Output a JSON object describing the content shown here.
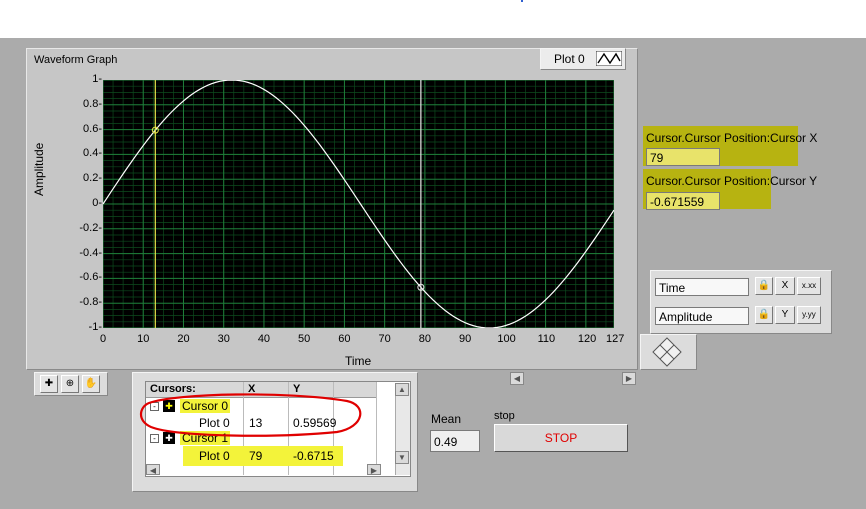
{
  "graph": {
    "title": "Waveform Graph",
    "plot_legend_label": "Plot 0",
    "xlabel": "Time",
    "ylabel": "Amplitude",
    "y_ticks": [
      "1",
      "0.8",
      "0.6",
      "0.4",
      "0.2",
      "0",
      "-0.2",
      "-0.4",
      "-0.6",
      "-0.8",
      "-1"
    ],
    "x_ticks": [
      "0",
      "10",
      "20",
      "30",
      "40",
      "50",
      "60",
      "70",
      "80",
      "90",
      "100",
      "110",
      "120",
      "127"
    ],
    "colors": {
      "plot_bg": "#000000",
      "grid": "#1f7f3a",
      "trace": "#ffffff",
      "cursor0": "#e6e64a",
      "cursor1": "#e8e8e8"
    }
  },
  "chart_data": {
    "type": "line",
    "title": "Waveform Graph",
    "xlabel": "Time",
    "ylabel": "Amplitude",
    "xlim": [
      0,
      127
    ],
    "ylim": [
      -1,
      1
    ],
    "grid": true,
    "legend": "top-right",
    "series": [
      {
        "name": "Plot 0",
        "function": "sine",
        "period": 128,
        "amplitude": 1,
        "points": 128
      }
    ],
    "cursors": [
      {
        "name": "Cursor 0",
        "x": 13,
        "y": 0.59569
      },
      {
        "name": "Cursor 1",
        "x": 79,
        "y": -0.6715
      }
    ]
  },
  "indicators": {
    "cursor_x_label": "Cursor.Cursor Position:Cursor X",
    "cursor_x_value": "79",
    "cursor_y_label": "Cursor.Cursor Position:Cursor Y",
    "cursor_y_value": "-0.671559"
  },
  "scale_legend": {
    "x_name": "Time",
    "y_name": "Amplitude",
    "lock_icon": "lock-icon",
    "x_autoscale": "X",
    "y_autoscale": "Y",
    "x_format": "x.xx",
    "y_format": "y.yy"
  },
  "cursor_table": {
    "headers": [
      "Cursors:",
      "X",
      "Y"
    ],
    "rows": [
      {
        "label": "Cursor 0",
        "x": "",
        "y": "",
        "kind": "cursor"
      },
      {
        "label": "Plot 0",
        "x": "13",
        "y": "0.59569",
        "kind": "plot"
      },
      {
        "label": "Cursor 1",
        "x": "",
        "y": "",
        "kind": "cursor"
      },
      {
        "label": "Plot 0",
        "x": "79",
        "y": "-0.6715",
        "kind": "plot"
      }
    ]
  },
  "mean": {
    "label": "Mean",
    "value": "0.49"
  },
  "stop": {
    "label": "stop",
    "button": "STOP"
  }
}
